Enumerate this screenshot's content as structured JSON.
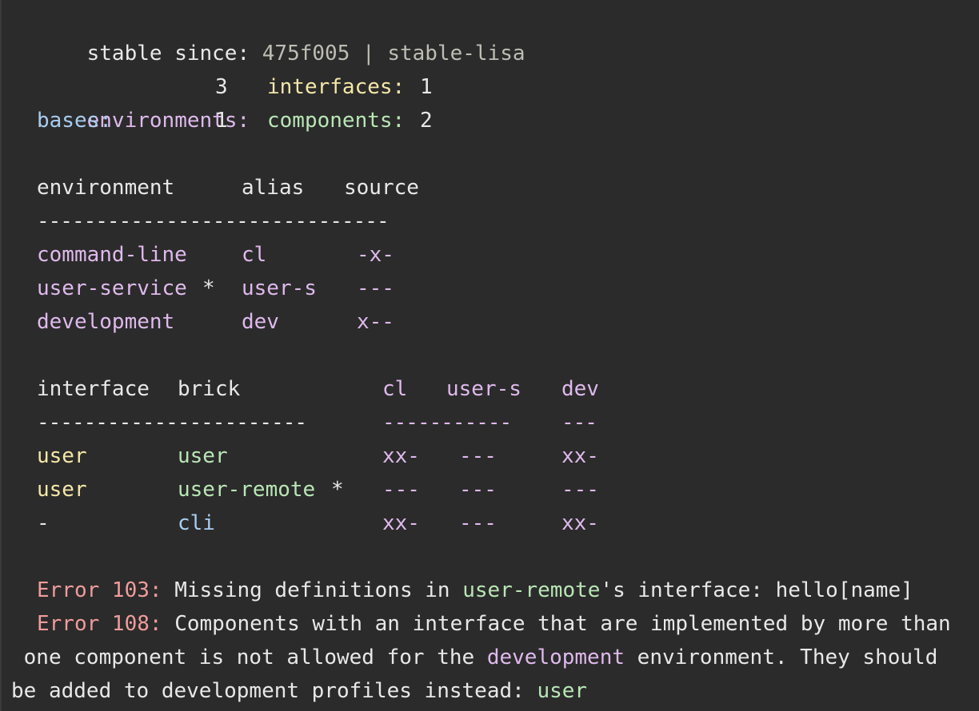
{
  "header": {
    "label": "stable since:",
    "commit": "475f005",
    "sep": "|",
    "tag": "stable-lisa"
  },
  "summary": {
    "environments_label": "environments:",
    "environments_count": "3",
    "interfaces_label": "interfaces:",
    "interfaces_count": "1",
    "bases_label": "bases:",
    "bases_count": "1",
    "components_label": "components:",
    "components_count": "2"
  },
  "env_table": {
    "headers": [
      "environment",
      "alias",
      "source"
    ],
    "divider": "------------------------------",
    "rows": [
      {
        "name": "command-line",
        "alias": "cl",
        "source": "-x-"
      },
      {
        "name": "user-service",
        "star": "*",
        "alias": "user-s",
        "source": "---"
      },
      {
        "name": "development",
        "alias": "dev",
        "source": "x--"
      }
    ]
  },
  "brick_table": {
    "headers": [
      "interface",
      "brick",
      "cl",
      "user-s",
      "dev"
    ],
    "dividers": [
      "-----------------------",
      "-----------",
      "---"
    ],
    "rows": [
      {
        "interface": "user",
        "brick": "user",
        "cl": "xx-",
        "user_s": "---",
        "dev": "xx-"
      },
      {
        "interface": "user",
        "brick": "user-remote",
        "star": "*",
        "cl": "---",
        "user_s": "---",
        "dev": "---"
      },
      {
        "interface": "-",
        "brick": "cli",
        "cl": "xx-",
        "user_s": "---",
        "dev": "xx-"
      }
    ]
  },
  "errors": {
    "e103_label": "Error 103:",
    "e103_text_a": " Missing definitions in ",
    "e103_brick": "user-remote",
    "e103_text_b": "'s interface: hello[name]",
    "e108_label": "Error 108:",
    "e108_text_a": " Components with an interface that are implemented by more than",
    "e108_line2_a": " one component is not allowed for the ",
    "e108_env": "development",
    "e108_line2_b": " environment. They should",
    "e108_line3_a": "be added to development profiles instead: ",
    "e108_interface": "user"
  },
  "colors": {
    "background": "#2b2b2b",
    "text": "#e8e8e8",
    "environment": "#dfb9ec",
    "base": "#a9cdf0",
    "interface": "#f4e7a8",
    "component": "#b9e6b5",
    "error": "#f09c9c"
  }
}
